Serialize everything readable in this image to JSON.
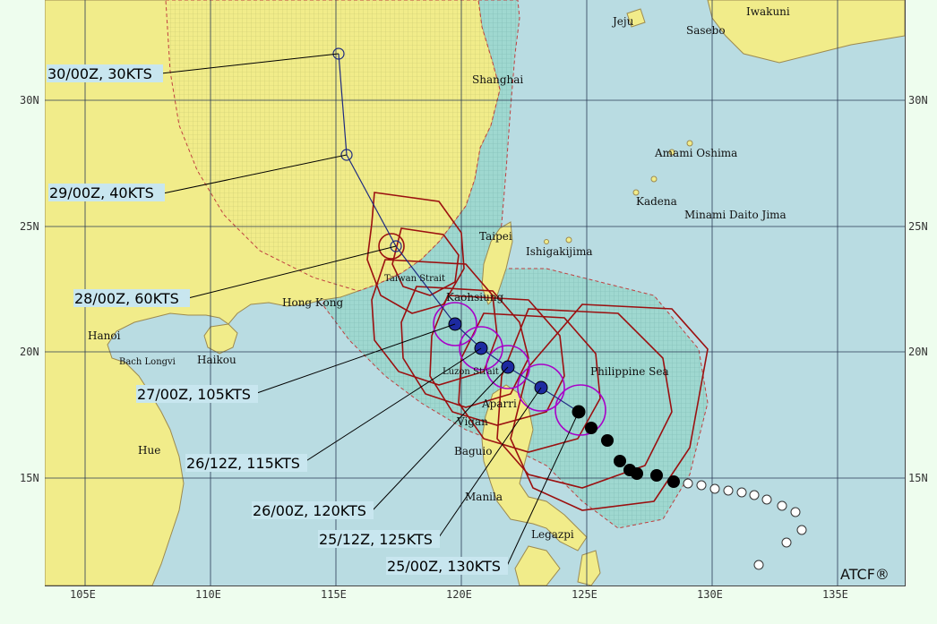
{
  "map": {
    "credit": "ATCF®",
    "colors": {
      "ocean": "#b9dce2",
      "land": "#f1ec8a",
      "land_hatch": "#c9c970",
      "warning_area": "#9fd8d0",
      "forecast_radii": "#9b1010",
      "wind34_radii": "#a800c8",
      "track_line": "#1e2a80",
      "past_track": "#000000",
      "future_center": "#1d2aa0",
      "land_border": "#c08a5a"
    },
    "lon_labels": [
      "105E",
      "110E",
      "115E",
      "120E",
      "125E",
      "130E",
      "135E"
    ],
    "lat_labels": [
      "30N",
      "25N",
      "20N",
      "15N"
    ],
    "places": [
      {
        "name": "Jeju"
      },
      {
        "name": "Iwakuni"
      },
      {
        "name": "Sasebo"
      },
      {
        "name": "Shanghai"
      },
      {
        "name": "Amami Oshima"
      },
      {
        "name": "Kadena"
      },
      {
        "name": "Minami Daito Jima"
      },
      {
        "name": "Taipei"
      },
      {
        "name": "Ishigakijima"
      },
      {
        "name": "Taiwan Strait"
      },
      {
        "name": "Kaohsiung"
      },
      {
        "name": "Hong Kong"
      },
      {
        "name": "Hanoi"
      },
      {
        "name": "Bach Longvi"
      },
      {
        "name": "Haikou"
      },
      {
        "name": "Luzon Strait"
      },
      {
        "name": "Philippine Sea"
      },
      {
        "name": "Aparri"
      },
      {
        "name": "Vigan"
      },
      {
        "name": "Baguio"
      },
      {
        "name": "Hue"
      },
      {
        "name": "Manila"
      },
      {
        "name": "Legazpi"
      }
    ],
    "forecast_points": [
      {
        "label": "30/00Z, 30KTS",
        "lat": 30.8,
        "lon": 115.1
      },
      {
        "label": "29/00Z, 40KTS",
        "lat": 27.8,
        "lon": 115.4
      },
      {
        "label": "28/00Z, 60KTS",
        "lat": 24.1,
        "lon": 117.3
      },
      {
        "label": "27/00Z, 105KTS",
        "lat": 21.2,
        "lon": 119.8
      },
      {
        "label": "26/12Z, 115KTS",
        "lat": 20.1,
        "lon": 120.8
      },
      {
        "label": "26/00Z, 120KTS",
        "lat": 19.4,
        "lon": 121.8
      },
      {
        "label": "25/12Z, 125KTS",
        "lat": 18.6,
        "lon": 123.1
      },
      {
        "label": "25/00Z, 130KTS",
        "lat": 17.7,
        "lon": 124.7
      }
    ]
  }
}
